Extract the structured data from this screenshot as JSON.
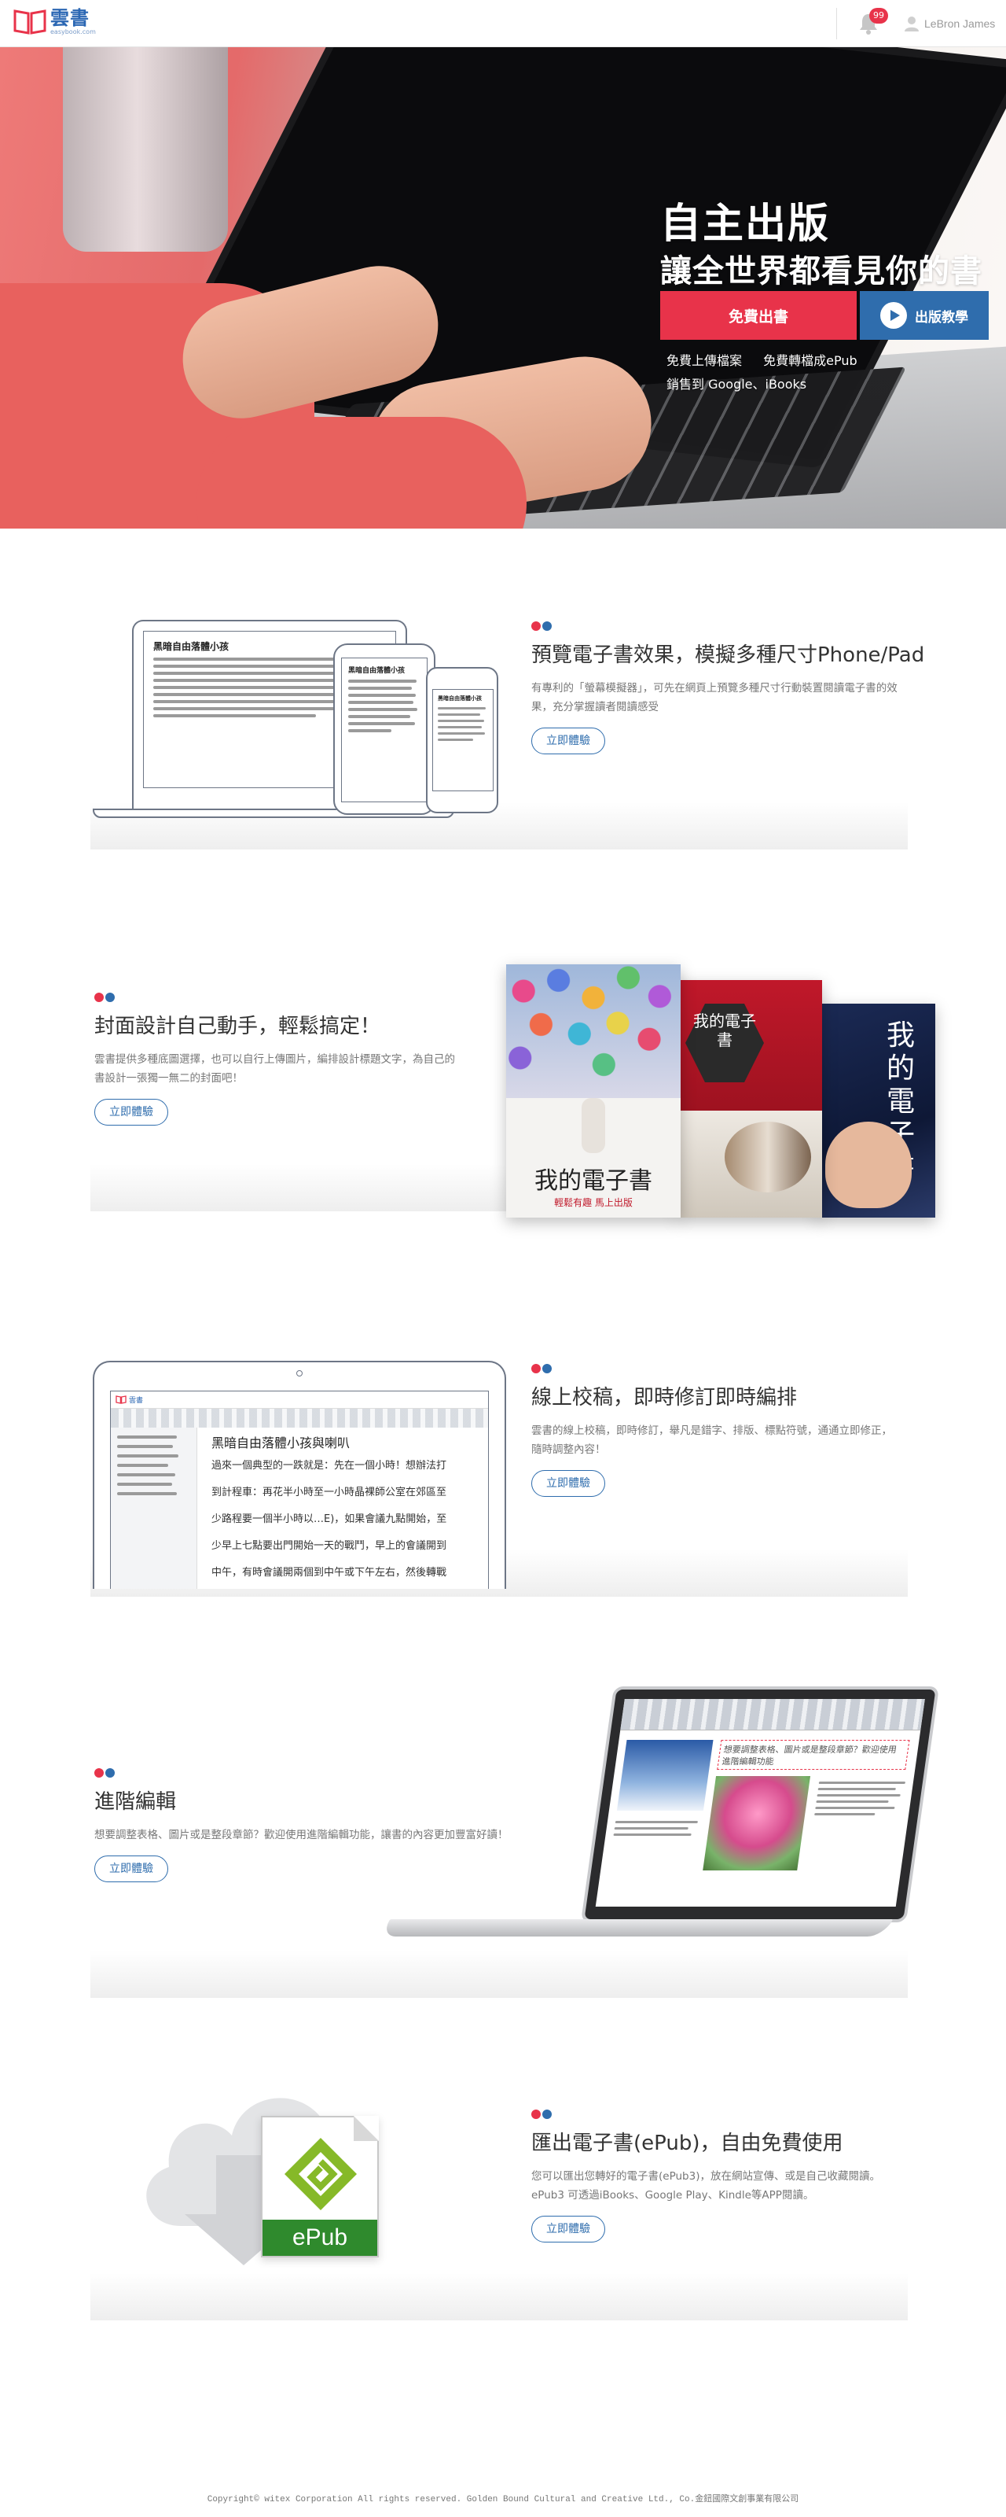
{
  "header": {
    "logo_text": "雲書",
    "logo_url": "easybook.com",
    "notification_count": "99",
    "user_name": "LeBron James"
  },
  "hero": {
    "title_line1": "自主出版",
    "title_line2": "讓全世界都看見你的書",
    "publish_button": "免費出書",
    "tutorial_button": "出版教學",
    "features": [
      "免費上傳檔案",
      "免費轉檔成ePub",
      "銷售到 Google、iBooks"
    ]
  },
  "features": [
    {
      "title": "預覽電子書效果，模擬多種尺寸Phone/Pad",
      "desc": "有專利的「螢幕模擬器」，可先在網頁上預覽多種尺寸行動裝置閱讀電子書的效果，充分掌握讀者閱讀感受",
      "button": "立即體驗"
    },
    {
      "title": "封面設計自己動手，輕鬆搞定！",
      "desc": "雲書提供多種底圖選擇，也可以自行上傳圖片，編排設計標題文字，為自己的書設計一張獨一無二的封面吧！",
      "button": "立即體驗"
    },
    {
      "title": "線上校稿，即時修訂即時編排",
      "desc": "雲書的線上校稿，即時修訂，舉凡是錯字、排版、標點符號，通通立即修正，隨時調整內容！",
      "button": "立即體驗"
    },
    {
      "title": "進階編輯",
      "desc": "想要調整表格、圖片或是整段章節？歡迎使用進階編輯功能，讓書的內容更加豐富好讀！",
      "button": "立即體驗"
    },
    {
      "title": "匯出電子書(ePub)，自由免費使用",
      "desc": "您可以匯出您轉好的電子書(ePub3)，放在網站宣傳、或是自己收藏閱讀。ePub3 可透過iBooks、Google Play、Kindle等APP閱讀。",
      "button": "立即體驗"
    }
  ],
  "mockups": {
    "doc_title": "黑暗自由落體小孩",
    "cover_main_title": "我的電子書",
    "cover_main_subtitle": "輕鬆有趣  馬上出版",
    "cover_mid_title": "我的電子書",
    "cover_right_title": "我的電子書",
    "editor_title": "黑暗自由落體小孩與喇叭",
    "editor_lines": [
      "過來一個典型的一跌就是：先在一個小時！想辦法打",
      "到計程車：再花半小時至一小時晶裸師公室在郊區至",
      "少路程要一個半小時以…E)，如果會議九點開始，至",
      "少早上七點要出門開始一天的戰鬥，早上的會議開到",
      "中午，有時會議開兩個到中午或下午左右，然後轉戰"
    ],
    "advanced_heading": "想要調整表格、圖片或是整段章節？歡迎使用進階編輯功能",
    "epub_label": "ePub"
  },
  "footer": {
    "text": "Copyright© witex Corporation  All rights reserved.   Golden Bound Cultural and Creative Ltd., Co.金鈕國際文創事業有限公司"
  },
  "colors": {
    "brand_red": "#e8334a",
    "brand_blue": "#2f6dad",
    "device_stroke": "#6d7686"
  }
}
